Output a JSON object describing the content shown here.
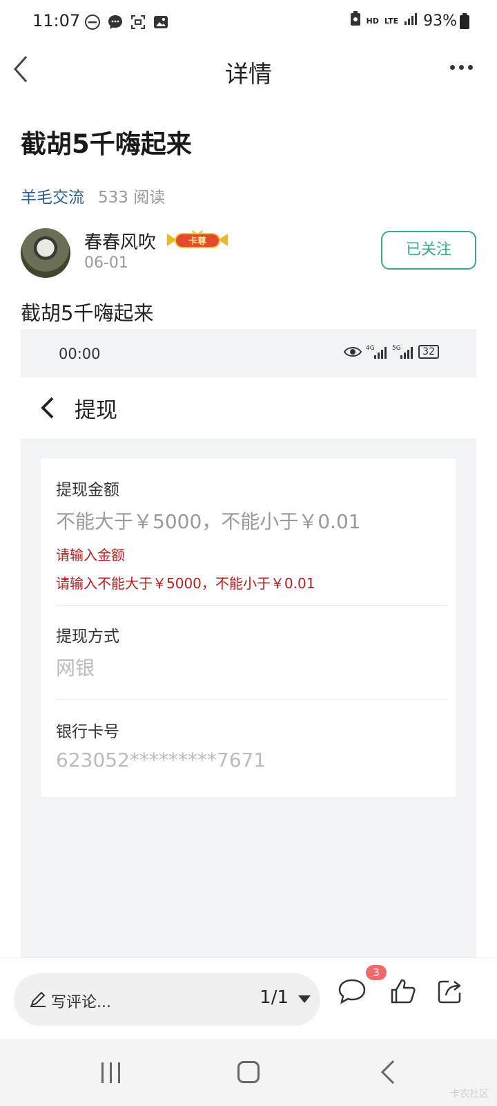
{
  "status_bar": {
    "time": "11:07",
    "hd_label": "HD",
    "lte_label": "LTE",
    "battery": "93%"
  },
  "header": {
    "title": "详情"
  },
  "post": {
    "title": "截胡5千嗨起来",
    "category": "羊毛交流",
    "reads": "533 阅读",
    "author": {
      "name": "春春风吹",
      "badge": "卡尊",
      "date": "06-01",
      "follow_label": "已关注"
    },
    "body": "截胡5千嗨起来"
  },
  "screenshot": {
    "status_time": "00:00",
    "signal_a": "4G",
    "signal_b": "5G",
    "battery": "32",
    "page_title": "提现",
    "amount": {
      "label": "提现金额",
      "placeholder": "不能大于￥5000，不能小于￥0.01",
      "error1": "请输入金额",
      "error2": "请输入不能大于￥5000，不能小于￥0.01"
    },
    "method": {
      "label": "提现方式",
      "value": "网银"
    },
    "card": {
      "label": "银行卡号",
      "value": "623052*********7671"
    }
  },
  "bottom_bar": {
    "comment_placeholder": "写评论...",
    "page_indicator": "1/1",
    "comment_count": "3"
  },
  "watermark": "卡农社区",
  "colors": {
    "accent": "#3aa98a",
    "category": "#2e5f8c",
    "error": "#b32020",
    "badge": "#f06a6a"
  }
}
